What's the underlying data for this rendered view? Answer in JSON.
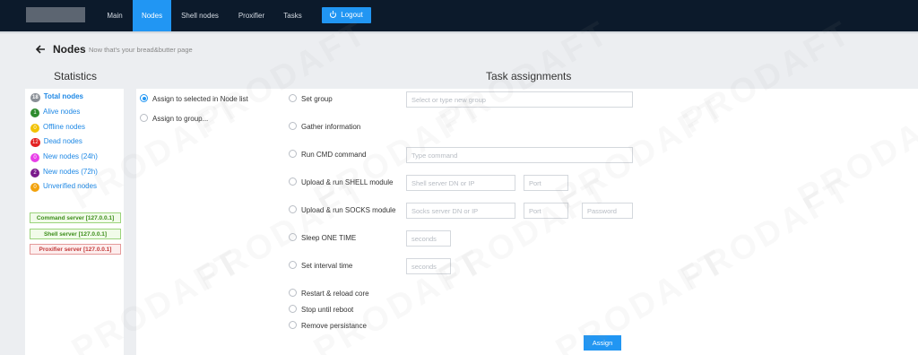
{
  "navbar": {
    "items": [
      {
        "label": "Main"
      },
      {
        "label": "Nodes"
      },
      {
        "label": "Shell nodes"
      },
      {
        "label": "Proxifier"
      },
      {
        "label": "Tasks"
      }
    ],
    "logout_label": "Logout",
    "active_tab": "Nodes"
  },
  "page": {
    "title": "Nodes",
    "subtitle": "Now that's your bread&butter page"
  },
  "stats": {
    "title": "Statistics",
    "items": [
      {
        "count": "18",
        "label": "Total nodes",
        "color": "#8a8f96"
      },
      {
        "count": "1",
        "label": "Alive nodes",
        "color": "#2e8b2e"
      },
      {
        "count": "0",
        "label": "Offline nodes",
        "color": "#f2c200"
      },
      {
        "count": "12",
        "label": "Dead nodes",
        "color": "#e32222"
      },
      {
        "count": "0",
        "label": "New nodes (24h)",
        "color": "#e83ee8"
      },
      {
        "count": "2",
        "label": "New nodes (72h)",
        "color": "#7a1a8c"
      },
      {
        "count": "0",
        "label": "Unverified nodes",
        "color": "#f2a20c"
      }
    ],
    "servers": [
      {
        "label": "Command server [127.0.0.1]",
        "status": "ok"
      },
      {
        "label": "Shell server [127.0.0.1]",
        "status": "ok"
      },
      {
        "label": "Proxifier server [127.0.0.1]",
        "status": "error"
      }
    ]
  },
  "target": {
    "options": [
      {
        "label": "Assign to selected in Node list",
        "checked": true
      },
      {
        "label": "Assign to group...",
        "checked": false
      }
    ]
  },
  "tasks": {
    "title": "Task assignments",
    "items": [
      {
        "label": "Set group"
      },
      {
        "label": "Gather information"
      },
      {
        "label": "Run CMD command"
      },
      {
        "label": "Upload & run SHELL module"
      },
      {
        "label": "Upload & run SOCKS module"
      },
      {
        "label": "Sleep ONE TIME"
      },
      {
        "label": "Set interval time"
      },
      {
        "label": "Restart & reload core"
      },
      {
        "label": "Stop until reboot"
      },
      {
        "label": "Remove persistance"
      }
    ],
    "placeholders": {
      "group": "Select or type new group",
      "cmd": "Type command",
      "shell_server": "Shell server DN or IP",
      "shell_port": "Port",
      "socks_server": "Socks server DN or IP",
      "socks_port": "Port",
      "socks_password": "Password",
      "sleep_seconds": "seconds",
      "interval_seconds": "seconds"
    },
    "assign_label": "Assign"
  },
  "watermark": "PRODAFT"
}
